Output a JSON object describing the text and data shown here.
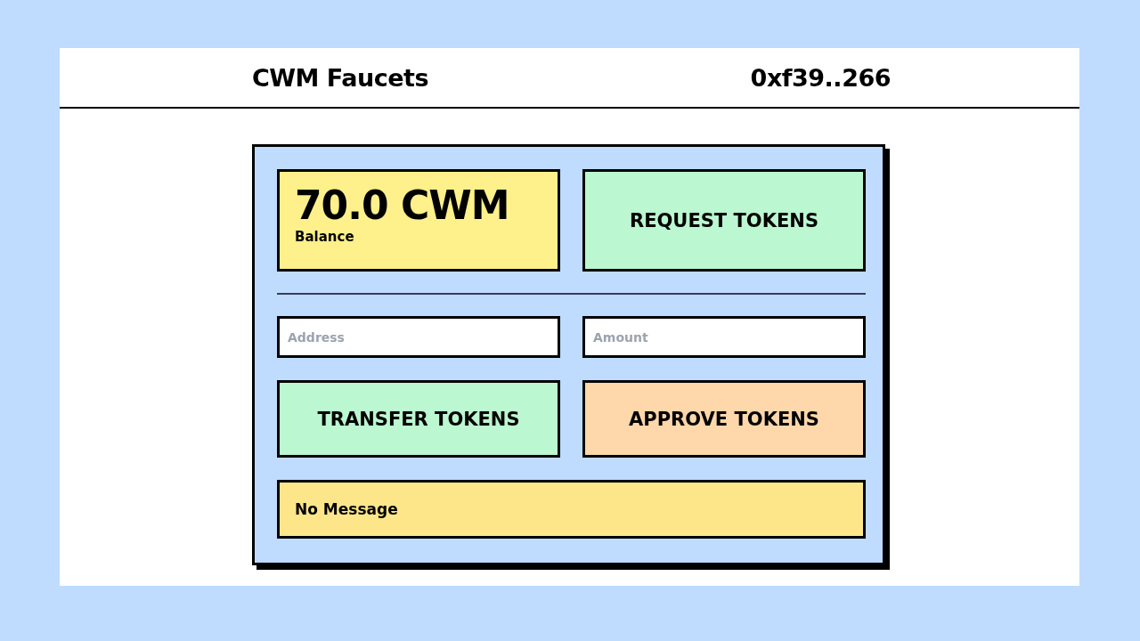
{
  "header": {
    "title": "CWM Faucets",
    "account": "0xf39..266"
  },
  "balance": {
    "amount": "70.0 CWM",
    "label": "Balance"
  },
  "request_button": {
    "label": "REQUEST TOKENS",
    "color": "#bbf7d0"
  },
  "fields": [
    {
      "placeholder": "Address"
    },
    {
      "placeholder": "Amount"
    }
  ],
  "buttons": [
    {
      "label": "TRANSFER TOKENS",
      "color": "#bbf7d0"
    },
    {
      "label": "APPROVE TOKENS",
      "color": "#fed7aa"
    }
  ],
  "message": "No Message"
}
